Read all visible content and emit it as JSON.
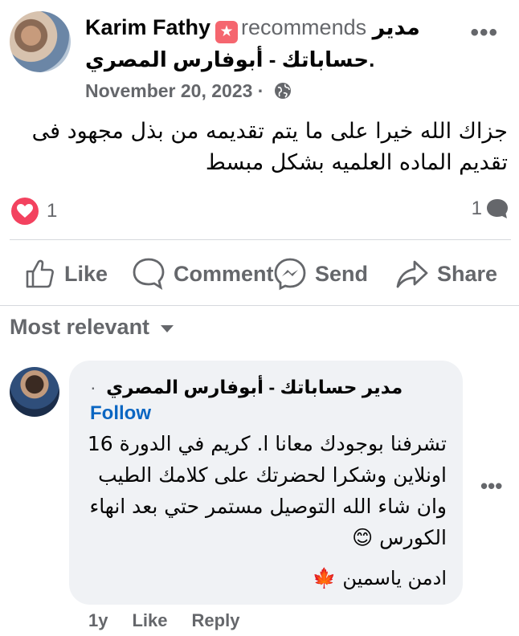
{
  "post": {
    "author": "Karim Fathy",
    "badge_icon": "star-icon",
    "verb": "recommends",
    "page_part1": "مدير",
    "page_part2": "حساباتك - أبوفارس المصري",
    "page_suffix": ".",
    "date": "November 20, 2023",
    "separator": "·",
    "privacy_icon": "globe-icon",
    "text": "جزاك الله خيرا على ما يتم تقديمه من بذل مجهود  فى تقديم الماده العلميه بشكل مبسط",
    "reaction_count": "1",
    "comment_count": "1"
  },
  "actions": {
    "like": "Like",
    "comment": "Comment",
    "send": "Send",
    "share": "Share"
  },
  "sort": {
    "label": "Most relevant"
  },
  "comment": {
    "author": "مدير حساباتك - أبوفارس المصري",
    "dot": "·",
    "follow": "Follow",
    "text": "تشرفنا بوجودك معانا ا. كريم في الدورة 16 اونلاين وشكرا لحضرتك على كلامك الطيب وان شاء الله التوصيل مستمر حتي بعد انهاء الكورس 😊",
    "signature": "ادمن ياسمين 🍁",
    "time": "1y",
    "like": "Like",
    "reply": "Reply"
  },
  "colors": {
    "accent": "#0a66c2",
    "heart": "#f3425f",
    "badge": "#f5666f",
    "secondary_text": "#65676b"
  }
}
